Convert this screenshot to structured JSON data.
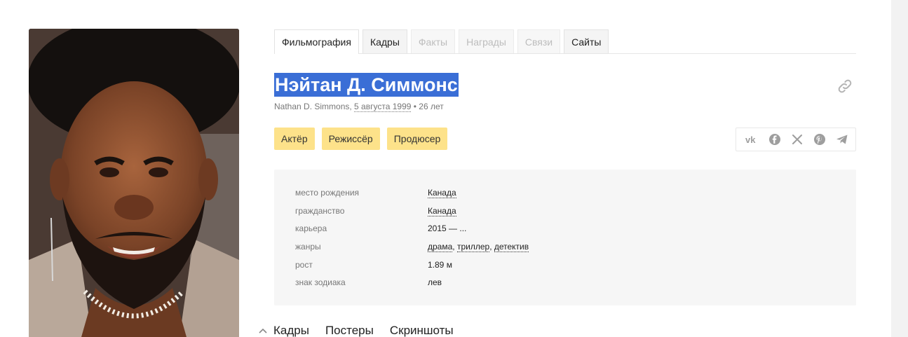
{
  "tabs": [
    {
      "label": "Фильмография",
      "state": "active"
    },
    {
      "label": "Кадры",
      "state": "normal"
    },
    {
      "label": "Факты",
      "state": "disabled"
    },
    {
      "label": "Награды",
      "state": "disabled"
    },
    {
      "label": "Связи",
      "state": "disabled"
    },
    {
      "label": "Сайты",
      "state": "normal"
    }
  ],
  "person": {
    "name": "Нэйтан Д. Симмонс",
    "original_name": "Nathan D. Simmons, ",
    "birth_date": "5 августа 1999",
    "age": " • 26 лет"
  },
  "roles": [
    "Актёр",
    "Режиссёр",
    "Продюсер"
  ],
  "share": {
    "icons": [
      "vk-icon",
      "facebook-icon",
      "x-icon",
      "pinterest-icon",
      "telegram-icon"
    ]
  },
  "info": {
    "birthplace": {
      "label": "место рождения",
      "value": "Канада"
    },
    "citizenship": {
      "label": "гражданство",
      "value": "Канада"
    },
    "career": {
      "label": "карьера",
      "value": "2015 — ..."
    },
    "genres": {
      "label": "жанры",
      "values": [
        "драма",
        "триллер",
        "детектив"
      ],
      "sep": ", "
    },
    "height": {
      "label": "рост",
      "value": "1.89 м"
    },
    "zodiac": {
      "label": "знак зодиака",
      "value": "лев"
    }
  },
  "media_tabs": [
    "Кадры",
    "Постеры",
    "Скриншоты"
  ],
  "colors": {
    "name_highlight": "#3a6ed6",
    "role_chip": "#fde28a",
    "info_background": "#f6f6f6"
  }
}
